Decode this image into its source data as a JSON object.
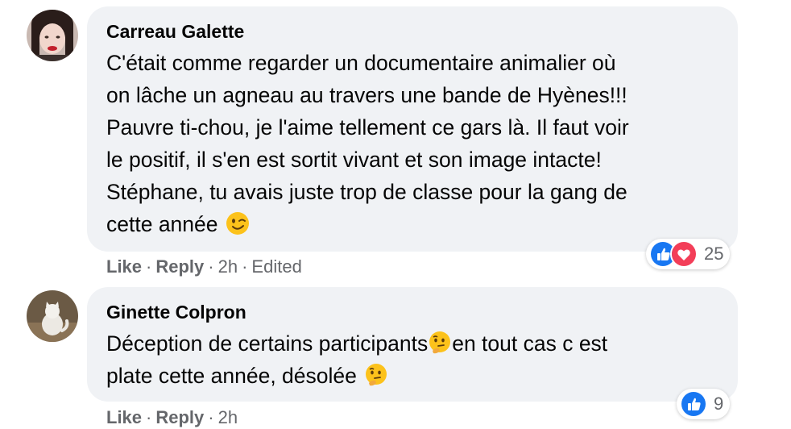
{
  "comments": [
    {
      "author": "Carreau Galette",
      "lines": [
        "C'était comme regarder un documentaire animalier où",
        "on lâche un agneau au travers une bande de Hyènes!!!",
        "Pauvre ti-chou, je l'aime tellement ce gars là. Il faut voir",
        "le positif, il s'en est sortit vivant et son image intacte!",
        "Stéphane, tu avais juste trop de classe pour la gang de",
        "cette année"
      ],
      "emoji": "winking-face",
      "actions": {
        "like": "Like",
        "reply": "Reply",
        "time": "2h",
        "edited": "Edited"
      },
      "reactions": {
        "types": [
          "like",
          "love"
        ],
        "count": "25"
      }
    },
    {
      "author": "Ginette Colpron",
      "lines": [
        "Déception de certains participants",
        "en tout cas c est",
        "plate cette année, désolée"
      ],
      "emoji": "thinking-face",
      "actions": {
        "like": "Like",
        "reply": "Reply",
        "time": "2h"
      },
      "reactions": {
        "types": [
          "like"
        ],
        "count": "9"
      }
    }
  ],
  "colors": {
    "bubble": "#f0f2f5",
    "text": "#050505",
    "secondary": "#65676b",
    "like_blue": "#1877f2",
    "love_red": "#f33e58",
    "emoji_yellow": "#fcc21b"
  }
}
